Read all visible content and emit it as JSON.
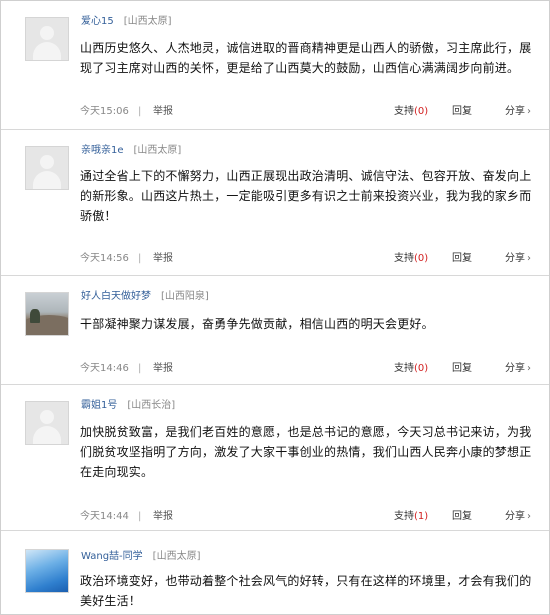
{
  "comments": [
    {
      "username": "爱心15",
      "location": "[山西太原]",
      "avatar_icon": "default-avatar-icon",
      "text": "山西历史悠久、人杰地灵，诚信进取的晋商精神更是山西人的骄傲，习主席此行，展现了习主席对山西的关怀，更是给了山西莫大的鼓励，山西信心满满阔步向前进。",
      "time": "今天15:06",
      "separator": "|",
      "report_label": "举报",
      "support_label": "支持",
      "support_count": "(0)",
      "reply_label": "回复",
      "share_label": "分享",
      "share_caret": "›"
    },
    {
      "username": "亲哦亲1e",
      "location": "[山西太原]",
      "avatar_icon": "default-avatar-icon",
      "text": "通过全省上下的不懈努力，山西正展现出政治清明、诚信守法、包容开放、奋发向上的新形象。山西这片热土，一定能吸引更多有识之士前来投资兴业，我为我的家乡而骄傲！",
      "time": "今天14:56",
      "separator": "|",
      "report_label": "举报",
      "support_label": "支持",
      "support_count": "(0)",
      "reply_label": "回复",
      "share_label": "分享",
      "share_caret": "›"
    },
    {
      "username": "好人白天做好梦",
      "location": "[山西阳泉]",
      "avatar_icon": "landscape-photo-avatar",
      "text": "干部凝神聚力谋发展，奋勇争先做贡献，相信山西的明天会更好。",
      "time": "今天14:46",
      "separator": "|",
      "report_label": "举报",
      "support_label": "支持",
      "support_count": "(0)",
      "reply_label": "回复",
      "share_label": "分享",
      "share_caret": "›"
    },
    {
      "username": "霸姐1号",
      "location": "[山西长治]",
      "avatar_icon": "default-avatar-icon",
      "text": "加快脱贫致富，是我们老百姓的意愿，也是总书记的意愿，今天习总书记来访，为我们脱贫攻坚指明了方向，激发了大家干事创业的热情，我们山西人民奔小康的梦想正在走向现实。",
      "time": "今天14:44",
      "separator": "|",
      "report_label": "举报",
      "support_label": "支持",
      "support_count": "(1)",
      "reply_label": "回复",
      "share_label": "分享",
      "share_caret": "›"
    },
    {
      "username": "Wang喆-同学",
      "location": "[山西太原]",
      "avatar_icon": "blue-photo-avatar",
      "text": "政治环境变好，也带动着整个社会风气的好转，只有在这样的环境里，才会有我们的美好生活！"
    }
  ],
  "colors": {
    "username": "#335f99",
    "support_count": "#d21e1e",
    "divider": "#d8d8d8"
  }
}
